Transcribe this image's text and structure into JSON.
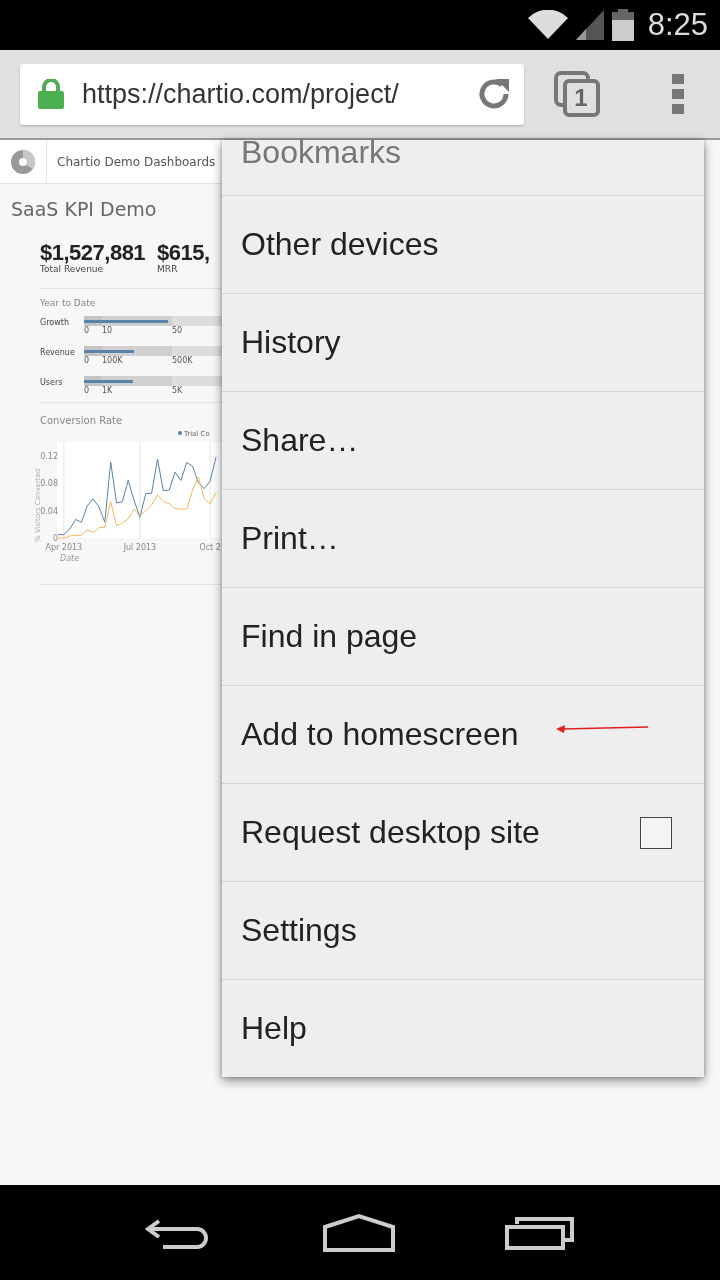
{
  "status_bar": {
    "time": "8:25"
  },
  "toolbar": {
    "url": "https://chartio.com/project/",
    "tab_count": "1"
  },
  "dashboard": {
    "breadcrumb": "Chartio Demo Dashboards",
    "title": "SaaS KPI Demo",
    "kpis": [
      {
        "value": "$1,527,881",
        "label": "Total Revenue"
      },
      {
        "value": "$615,",
        "label": "MRR"
      }
    ],
    "section": "Year to Date",
    "bullets": [
      {
        "label": "Growth",
        "level": 0.61,
        "ticks": [
          "0",
          "10",
          "50"
        ]
      },
      {
        "label": "Revenue",
        "level": 0.36,
        "ticks": [
          "0",
          "100K",
          "500K"
        ]
      },
      {
        "label": "Users",
        "level": 0.355,
        "ticks": [
          "0",
          "1K",
          "5K"
        ]
      }
    ],
    "chart_title": "Conversion Rate",
    "chart_data": {
      "type": "line",
      "xlabel": "Date",
      "ylabel": "% Visitors Converted",
      "categories": [
        null,
        "Apr 2013",
        null,
        null,
        null,
        null,
        null,
        null,
        null,
        null,
        null,
        null,
        null,
        null,
        "Jul 2013",
        null,
        null,
        null,
        null,
        null,
        null,
        null,
        null,
        null,
        null,
        null,
        "Oct 2",
        null
      ],
      "ylim": [
        0,
        0.14
      ],
      "grid": true,
      "yticks": [
        {
          "value": 0,
          "label": "0"
        },
        {
          "value": 0.04,
          "label": "0.04"
        },
        {
          "value": 0.08,
          "label": "0.08"
        },
        {
          "value": 0.12,
          "label": "0.12"
        }
      ],
      "series": [
        {
          "name": "Trial Co",
          "color": "#5b82a8",
          "values": [
            0.005,
            0.005,
            0.013,
            0.027,
            0.023,
            0.047,
            0.057,
            0.045,
            0.023,
            0.111,
            0.051,
            0.053,
            0.084,
            0.055,
            0.03,
            0.065,
            0.065,
            0.115,
            0.069,
            0.07,
            0.096,
            0.084,
            0.11,
            0.105,
            0.08,
            0.072,
            0.083,
            0.118
          ]
        },
        {
          "color": "#f5b660",
          "values": [
            0,
            0,
            0.003,
            0.004,
            0.004,
            0.012,
            0.008,
            0.015,
            0.016,
            0.053,
            0.018,
            0.022,
            0.028,
            0.042,
            0.032,
            0.04,
            0.048,
            0.063,
            0.053,
            0.05,
            0.043,
            0.042,
            0.042,
            0.07,
            0.089,
            0.057,
            0.05,
            0.066
          ]
        }
      ]
    }
  },
  "menu": {
    "items": [
      {
        "kind": "text",
        "label": "Bookmarks",
        "arrow": false
      },
      {
        "kind": "text",
        "label": "Other devices",
        "arrow": false
      },
      {
        "kind": "text",
        "label": "History",
        "arrow": false
      },
      {
        "kind": "text",
        "label": "Share…",
        "arrow": false
      },
      {
        "kind": "text",
        "label": "Print…",
        "arrow": false
      },
      {
        "kind": "text",
        "label": "Find in page",
        "arrow": false
      },
      {
        "kind": "text",
        "label": "Add to homescreen",
        "arrow": true
      },
      {
        "kind": "checkbox",
        "label": "Request desktop site",
        "checked": false,
        "arrow": false
      },
      {
        "kind": "text",
        "label": "Settings",
        "arrow": false
      },
      {
        "kind": "text",
        "label": "Help",
        "arrow": false
      }
    ]
  }
}
